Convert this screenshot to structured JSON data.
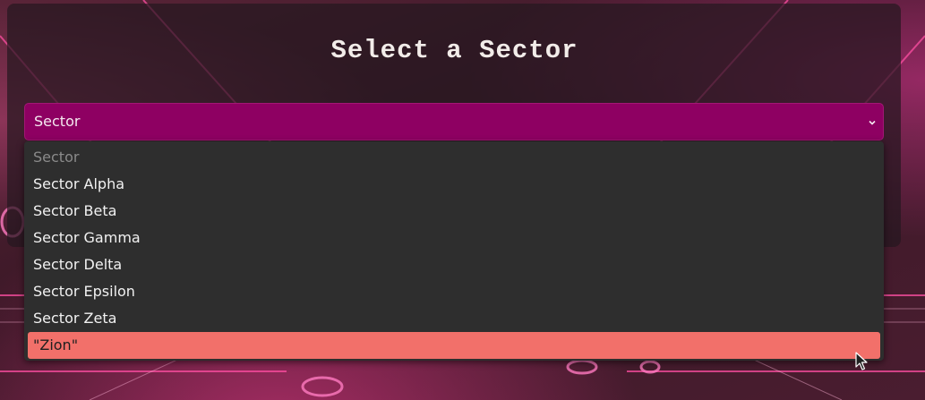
{
  "page": {
    "title": "Select a Sector"
  },
  "select": {
    "value": "Sector",
    "options": [
      {
        "label": "Sector",
        "disabled": true
      },
      {
        "label": "Sector Alpha"
      },
      {
        "label": "Sector Beta"
      },
      {
        "label": "Sector Gamma"
      },
      {
        "label": "Sector Delta"
      },
      {
        "label": "Sector Epsilon"
      },
      {
        "label": "Sector Zeta"
      },
      {
        "label": "\"Zion\"",
        "highlighted": true
      }
    ]
  },
  "colors": {
    "select_bg": "#8e0062",
    "dropdown_bg": "#2e2e2e",
    "highlight": "#f2706a",
    "title_text": "#f2ece9"
  },
  "icons": {
    "select_arrow": "chevron-down-icon",
    "pointer": "mouse-cursor-icon"
  }
}
